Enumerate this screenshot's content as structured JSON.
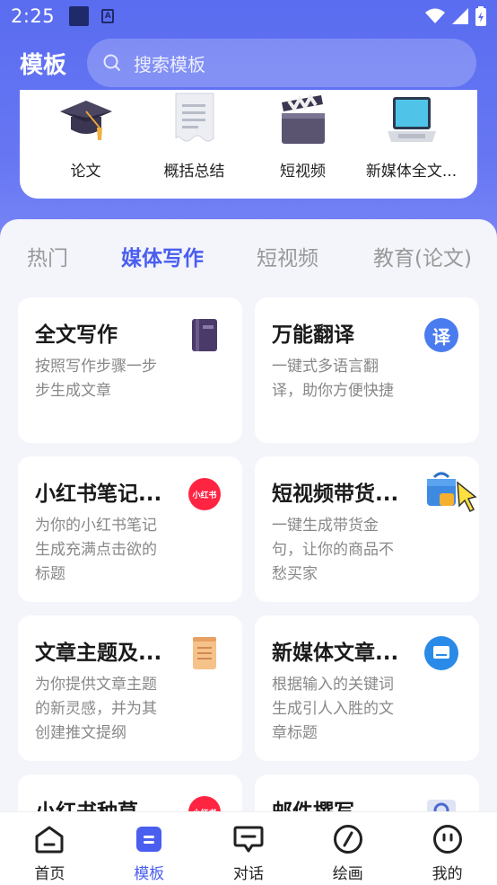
{
  "status_bar": {
    "time": "2:25"
  },
  "header": {
    "title": "模板",
    "search_placeholder": "搜索模板"
  },
  "categories": [
    {
      "label": "论文",
      "icon": "graduation-cap-icon"
    },
    {
      "label": "概括总结",
      "icon": "document-icon"
    },
    {
      "label": "短视频",
      "icon": "clapperboard-icon"
    },
    {
      "label": "新媒体全文...",
      "icon": "laptop-icon"
    }
  ],
  "tabs": [
    {
      "label": "热门"
    },
    {
      "label": "媒体写作",
      "active": true
    },
    {
      "label": "短视频"
    },
    {
      "label": "教育(论文)"
    }
  ],
  "cards": [
    {
      "title": "全文写作",
      "desc": "按照写作步骤一步步生成文章",
      "icon": "book-icon"
    },
    {
      "title": "万能翻译",
      "desc": "一键式多语言翻译，助你方便快捷",
      "icon": "translate-icon",
      "icon_text": "译"
    },
    {
      "title": "小红书笔记...",
      "desc": "为你的小红书笔记生成充满点击欲的标题",
      "icon": "xiaohongshu-icon",
      "icon_text": "小红书"
    },
    {
      "title": "短视频带货...",
      "desc": "一键生成带货金句，让你的商品不愁买家",
      "icon": "shopping-bag-icon"
    },
    {
      "title": "文章主题及...",
      "desc": "为你提供文章主题的新灵感，并为其创建推文提纲",
      "icon": "scroll-icon"
    },
    {
      "title": "新媒体文章...",
      "desc": "根据输入的关键词生成引人入胜的文章标题",
      "icon": "screen-icon"
    },
    {
      "title": "小红书种草",
      "desc": "",
      "icon": "xiaohongshu-icon",
      "icon_text": "小红书"
    },
    {
      "title": "邮件撰写",
      "desc": "",
      "icon": "mail-icon"
    }
  ],
  "bottom_nav": [
    {
      "label": "首页",
      "icon": "home-icon"
    },
    {
      "label": "模板",
      "icon": "template-icon",
      "active": true
    },
    {
      "label": "对话",
      "icon": "chat-icon"
    },
    {
      "label": "绘画",
      "icon": "compass-icon"
    },
    {
      "label": "我的",
      "icon": "profile-icon"
    }
  ],
  "colors": {
    "accent": "#4a5ef0",
    "header_bg": "#5a6cf0",
    "xiaohongshu_red": "#ff2442"
  }
}
